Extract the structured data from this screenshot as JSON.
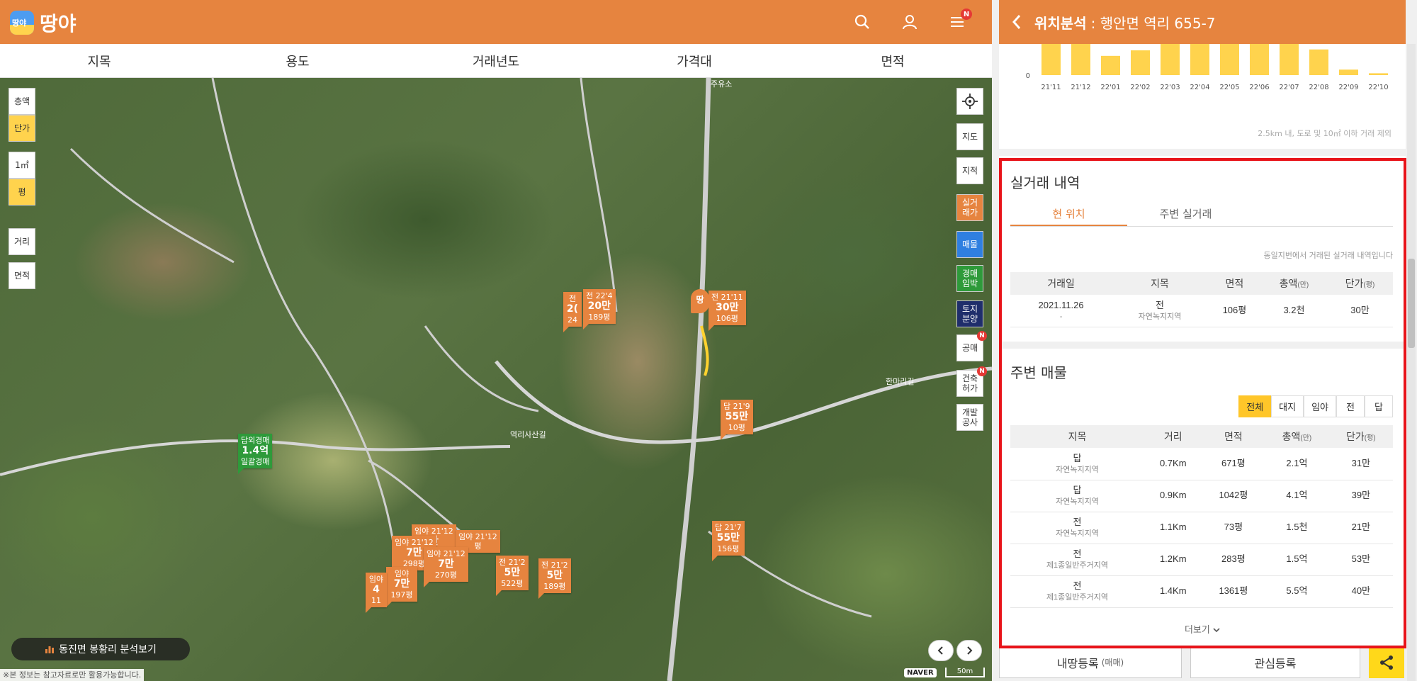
{
  "app": {
    "name": "땅야"
  },
  "filters": [
    "지목",
    "용도",
    "거래년도",
    "가격대",
    "면적"
  ],
  "left_controls": {
    "total": "총액",
    "unit": "단가",
    "sqm": "1㎡",
    "pyeong": "평",
    "distance": "거리",
    "area": "면적"
  },
  "right_controls": {
    "map": "지도",
    "cadastral": "지적",
    "real_deal": "실거\n래가",
    "listing": "매물",
    "auction": "경매\n임박",
    "land_sale": "토지\n분양",
    "public_sale": "공매",
    "building": "건축\n허가",
    "dev": "개발\n공사",
    "badge": "N"
  },
  "markers": [
    {
      "id": "m1",
      "lines": [
        "전 21'11"
      ],
      "price": "30만",
      "size": "106평"
    },
    {
      "id": "m2",
      "lines": [
        "전 22'4"
      ],
      "price": "20만",
      "size": "189평"
    },
    {
      "id": "m3",
      "lines": [
        "전"
      ],
      "price": "2(",
      "size": "24"
    },
    {
      "id": "m4",
      "lines": [
        "답 21'9"
      ],
      "price": "55만",
      "size": "10평"
    },
    {
      "id": "m5",
      "lines": [
        "답 21'7"
      ],
      "price": "55만",
      "size": "156평"
    },
    {
      "id": "m6",
      "lines": [
        "전 21'2"
      ],
      "price": "5만",
      "size": "522평"
    },
    {
      "id": "m7",
      "lines": [
        "전 21'2"
      ],
      "price": "5만",
      "size": "189평"
    },
    {
      "id": "m8",
      "lines": [
        "임야 21'12"
      ],
      "price": "7만",
      "size": "298평"
    },
    {
      "id": "m9",
      "lines": [
        "임야 21'12"
      ],
      "price": "7만",
      "size": "270평"
    },
    {
      "id": "m10",
      "lines": [
        "임야 21'12"
      ],
      "price": "만",
      "size": ""
    },
    {
      "id": "m11",
      "lines": [
        "임야 21'12"
      ],
      "price": "",
      "size": "평"
    },
    {
      "id": "m12",
      "lines": [
        "임야"
      ],
      "price": "7만",
      "size": "197평"
    },
    {
      "id": "m13",
      "lines": [
        "임야"
      ],
      "price": "4",
      "size": "11"
    },
    {
      "id": "m14",
      "lines": [
        "답외경매"
      ],
      "price": "1.4억",
      "size": "일괄경매",
      "green": true
    }
  ],
  "pin_label": "땅",
  "map_labels": {
    "gas": "주유소",
    "road1": "역리사산길",
    "road2": "한마리길"
  },
  "analysis_button": "동진면 봉황리 분석보기",
  "disclaimer": "※본 정보는 참고자료로만 활용가능합니다.",
  "map_footer": {
    "naver": "NAVER",
    "scale": "50m"
  },
  "panel": {
    "title": "위치분석",
    "address": ": 행안면 역리 655-7"
  },
  "monthly_chart": {
    "chart_data": {
      "type": "bar",
      "categories": [
        "21'11",
        "21'12",
        "22'01",
        "22'02",
        "22'03",
        "22'04",
        "22'05",
        "22'06",
        "22'07",
        "22'08",
        "22'09",
        "22'10"
      ],
      "values": [
        34,
        34,
        21,
        27,
        34,
        34,
        34,
        34,
        34,
        28,
        6,
        2
      ],
      "ylim": [
        0,
        34
      ],
      "ytick": "0",
      "color": "#ffd34d"
    },
    "note": "2.5km 내, 도로 및 10㎡ 이하 거래 제외"
  },
  "deals": {
    "title": "실거래 내역",
    "tabs": [
      "현 위치",
      "주변 실거래"
    ],
    "note": "동일지번에서 거래된 실거래 내역입니다",
    "headers": [
      "거래일",
      "지목",
      "면적",
      "총액",
      "단가"
    ],
    "header_units": {
      "total": "(만)",
      "unit": "(평)"
    },
    "rows": [
      {
        "date": "2021.11.26",
        "date_sub": "-",
        "jimok": "전",
        "zone": "자연녹지지역",
        "area": "106평",
        "total": "3.2천",
        "unit": "30만"
      }
    ]
  },
  "listings": {
    "title": "주변 매물",
    "chips": [
      "전체",
      "대지",
      "임야",
      "전",
      "답"
    ],
    "headers": [
      "지목",
      "거리",
      "면적",
      "총액",
      "단가"
    ],
    "header_units": {
      "total": "(만)",
      "unit": "(평)"
    },
    "rows": [
      {
        "jimok": "답",
        "zone": "자연녹지지역",
        "dist": "0.7Km",
        "area": "671평",
        "total": "2.1억",
        "unit": "31만"
      },
      {
        "jimok": "답",
        "zone": "자연녹지지역",
        "dist": "0.9Km",
        "area": "1042평",
        "total": "4.1억",
        "unit": "39만"
      },
      {
        "jimok": "전",
        "zone": "자연녹지지역",
        "dist": "1.1Km",
        "area": "73평",
        "total": "1.5천",
        "unit": "21만"
      },
      {
        "jimok": "전",
        "zone": "제1종일반주거지역",
        "dist": "1.2Km",
        "area": "283평",
        "total": "1.5억",
        "unit": "53만"
      },
      {
        "jimok": "전",
        "zone": "제1종일반주거지역",
        "dist": "1.4Km",
        "area": "1361평",
        "total": "5.5억",
        "unit": "40만"
      }
    ],
    "more": "더보기"
  },
  "bottom": {
    "register": "내땅등록",
    "register_sub": "(매매)",
    "interest": "관심등록"
  },
  "colors": {
    "brand": "#e6843f",
    "accent": "#ffc629",
    "highlight": "#e8141a"
  }
}
